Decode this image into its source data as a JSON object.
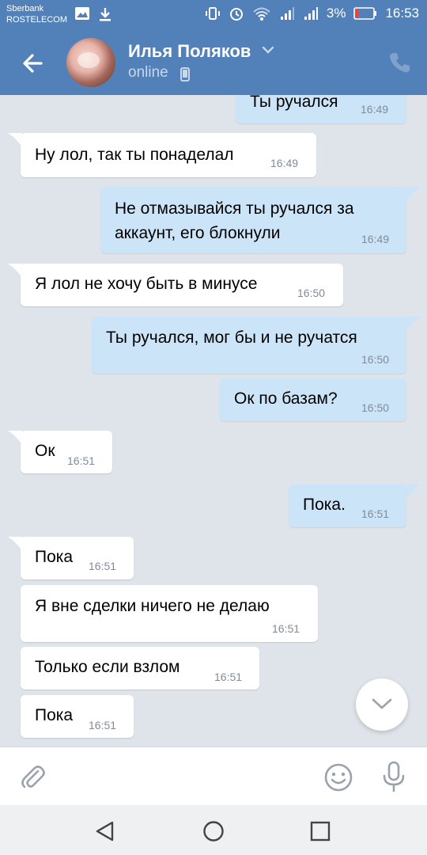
{
  "status_bar": {
    "carrier_line1": "Sberbank",
    "carrier_line2": "ROSTELECOM",
    "battery": "3%",
    "time": "16:53"
  },
  "header": {
    "name": "Илья Поляков",
    "status": "online"
  },
  "messages": [
    {
      "dir": "out",
      "text": "Ты ручался",
      "time": "16:49"
    },
    {
      "dir": "in",
      "text": "Ну лол, так ты понаделал",
      "time": "16:49"
    },
    {
      "dir": "out",
      "text_line1": "Не отмазывайся ты ручался за",
      "text_line2": "аккаунт, его блокнули",
      "time": "16:49"
    },
    {
      "dir": "in",
      "text": "Я лол не хочу быть в минусе",
      "time": "16:50"
    },
    {
      "dir": "out",
      "text": "Ты ручался, мог бы и не ручатся",
      "time": "16:50"
    },
    {
      "dir": "out",
      "text": "Ок по базам?",
      "time": "16:50"
    },
    {
      "dir": "in",
      "text": "Ок",
      "time": "16:51"
    },
    {
      "dir": "out",
      "text": "Пока.",
      "time": "16:51"
    },
    {
      "dir": "in",
      "text": "Пока",
      "time": "16:51"
    },
    {
      "dir": "in",
      "text": "Я вне сделки ничего не делаю",
      "time": "16:51"
    },
    {
      "dir": "in",
      "text": "Только если взлом",
      "time": "16:51"
    },
    {
      "dir": "in",
      "text": "Пока",
      "time": "16:51"
    }
  ],
  "colors": {
    "header": "#5181b8",
    "background": "#dfe4ea",
    "bubble_in": "#ffffff",
    "bubble_out": "#cce4f7",
    "time": "#818c99"
  },
  "icons": [
    "back-arrow-icon",
    "chevron-down-icon",
    "phone-icon",
    "mobile-status-icon",
    "attach-icon",
    "emoji-icon",
    "mic-icon",
    "scroll-down-icon",
    "nav-back-icon",
    "nav-home-icon",
    "nav-recent-icon"
  ]
}
